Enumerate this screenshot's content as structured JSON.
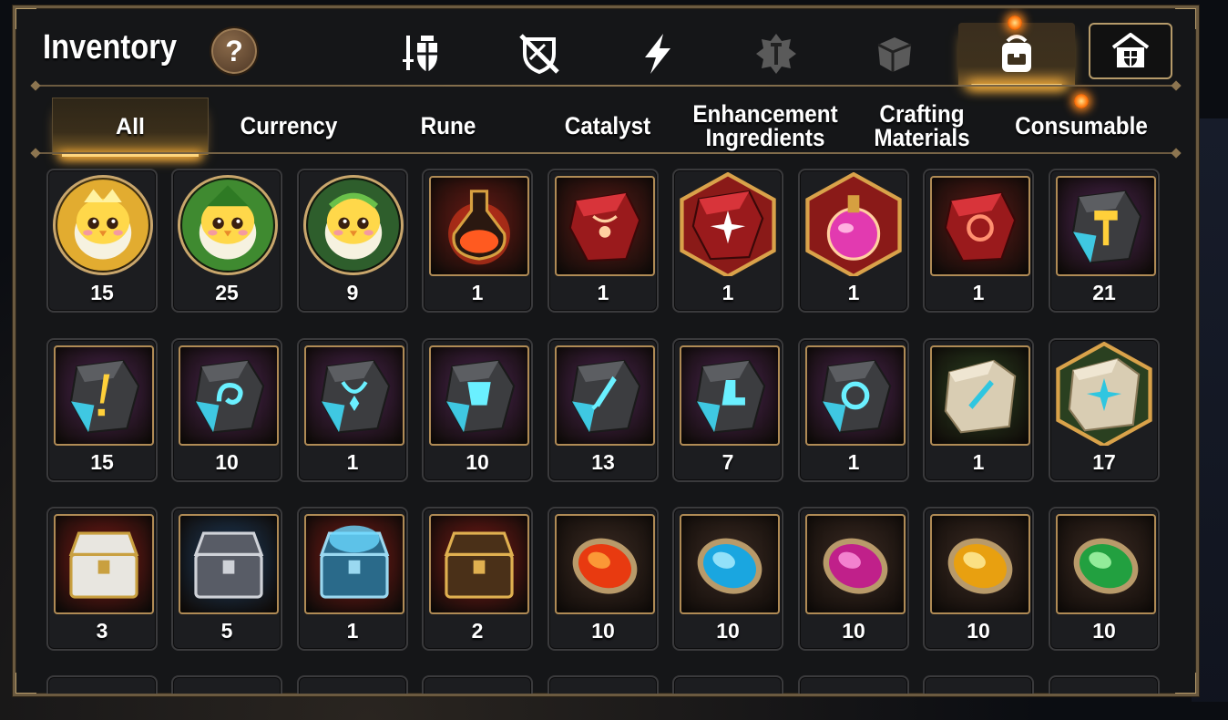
{
  "window": {
    "title": "Inventory",
    "help_label": "?"
  },
  "category_tabs": [
    {
      "icon": "knight-shield-icon",
      "active": false
    },
    {
      "icon": "broken-shield-icon",
      "active": false
    },
    {
      "icon": "lightning-icon",
      "active": false
    },
    {
      "icon": "rune-emblem-icon",
      "active": false
    },
    {
      "icon": "crystal-cube-icon",
      "active": false
    },
    {
      "icon": "backpack-icon",
      "active": true,
      "notification": true
    }
  ],
  "inbox_button": {
    "icon": "shield-house-icon"
  },
  "sub_tabs": [
    {
      "label": "All",
      "active": true
    },
    {
      "label": "Currency"
    },
    {
      "label": "Rune"
    },
    {
      "label": "Catalyst"
    },
    {
      "label": "Enhancement\nIngredients"
    },
    {
      "label": "Crafting\nMaterials"
    },
    {
      "label": "Consumable",
      "notification": true
    }
  ],
  "items_row1": [
    {
      "icon": "gold-chick-coin-icon",
      "frame": "circle",
      "bg": "#d9a530",
      "qty": "15"
    },
    {
      "icon": "green-chick-coin-icon",
      "frame": "circle",
      "bg": "#2f6b2a",
      "qty": "25"
    },
    {
      "icon": "laurel-chick-coin-icon",
      "frame": "circle",
      "bg": "#234d24",
      "qty": "9"
    },
    {
      "icon": "red-flask-icon",
      "frame": "square",
      "bg": "#6a1a14",
      "qty": "1"
    },
    {
      "icon": "red-pendant-gem-icon",
      "frame": "square",
      "bg": "#5a1a16",
      "qty": "1"
    },
    {
      "icon": "red-star-gem-icon",
      "frame": "hex",
      "bg": "#8a1a18",
      "qty": "1"
    },
    {
      "icon": "pink-potion-icon",
      "frame": "hex",
      "bg": "#8a1a18",
      "qty": "1"
    },
    {
      "icon": "red-ring-gem-icon",
      "frame": "square",
      "bg": "#5a1a16",
      "qty": "1"
    },
    {
      "icon": "hammer-stone-icon",
      "frame": "square",
      "bg": "#4a2450",
      "qty": "21"
    }
  ],
  "items_row2": [
    {
      "icon": "exclaim-stone-icon",
      "frame": "square",
      "bg": "#4a2450",
      "qty": "15"
    },
    {
      "icon": "swirl-stone-icon",
      "frame": "square",
      "bg": "#4a2450",
      "qty": "10"
    },
    {
      "icon": "necklace-stone-icon",
      "frame": "square",
      "bg": "#4a2450",
      "qty": "1"
    },
    {
      "icon": "armor-stone-icon",
      "frame": "square",
      "bg": "#4a2450",
      "qty": "10"
    },
    {
      "icon": "sword-stone-icon",
      "frame": "square",
      "bg": "#4a2450",
      "qty": "13"
    },
    {
      "icon": "boot-stone-icon",
      "frame": "square",
      "bg": "#4a2450",
      "qty": "7"
    },
    {
      "icon": "ring-stone-icon",
      "frame": "square",
      "bg": "#4a2450",
      "qty": "1"
    },
    {
      "icon": "sword-tablet-icon",
      "frame": "square",
      "bg": "#2a4020",
      "qty": "1"
    },
    {
      "icon": "star-tablet-icon",
      "frame": "hex",
      "bg": "#2a4020",
      "qty": "17"
    }
  ],
  "items_row3": [
    {
      "icon": "white-chest-icon",
      "frame": "square",
      "bg": "#7a1a16",
      "qty": "3"
    },
    {
      "icon": "steel-chest-icon",
      "frame": "square",
      "bg": "#1c3a5a",
      "qty": "5"
    },
    {
      "icon": "blue-glow-chest-icon",
      "frame": "square",
      "bg": "#7a1a16",
      "qty": "1"
    },
    {
      "icon": "gold-chest-icon",
      "frame": "square",
      "bg": "#7a1a16",
      "qty": "2"
    },
    {
      "icon": "fire-catalyst-icon",
      "frame": "square",
      "bg": "#3a2a22",
      "qty": "10"
    },
    {
      "icon": "ice-catalyst-icon",
      "frame": "square",
      "bg": "#3a2a22",
      "qty": "10"
    },
    {
      "icon": "moon-catalyst-icon",
      "frame": "square",
      "bg": "#3a2a22",
      "qty": "10"
    },
    {
      "icon": "sun-catalyst-icon",
      "frame": "square",
      "bg": "#3a2a22",
      "qty": "10"
    },
    {
      "icon": "nature-catalyst-icon",
      "frame": "square",
      "bg": "#3a2a22",
      "qty": "10"
    }
  ],
  "colors": {
    "gold": "#c9a66c",
    "panel": "#151618",
    "glow": "#ffb43c"
  }
}
